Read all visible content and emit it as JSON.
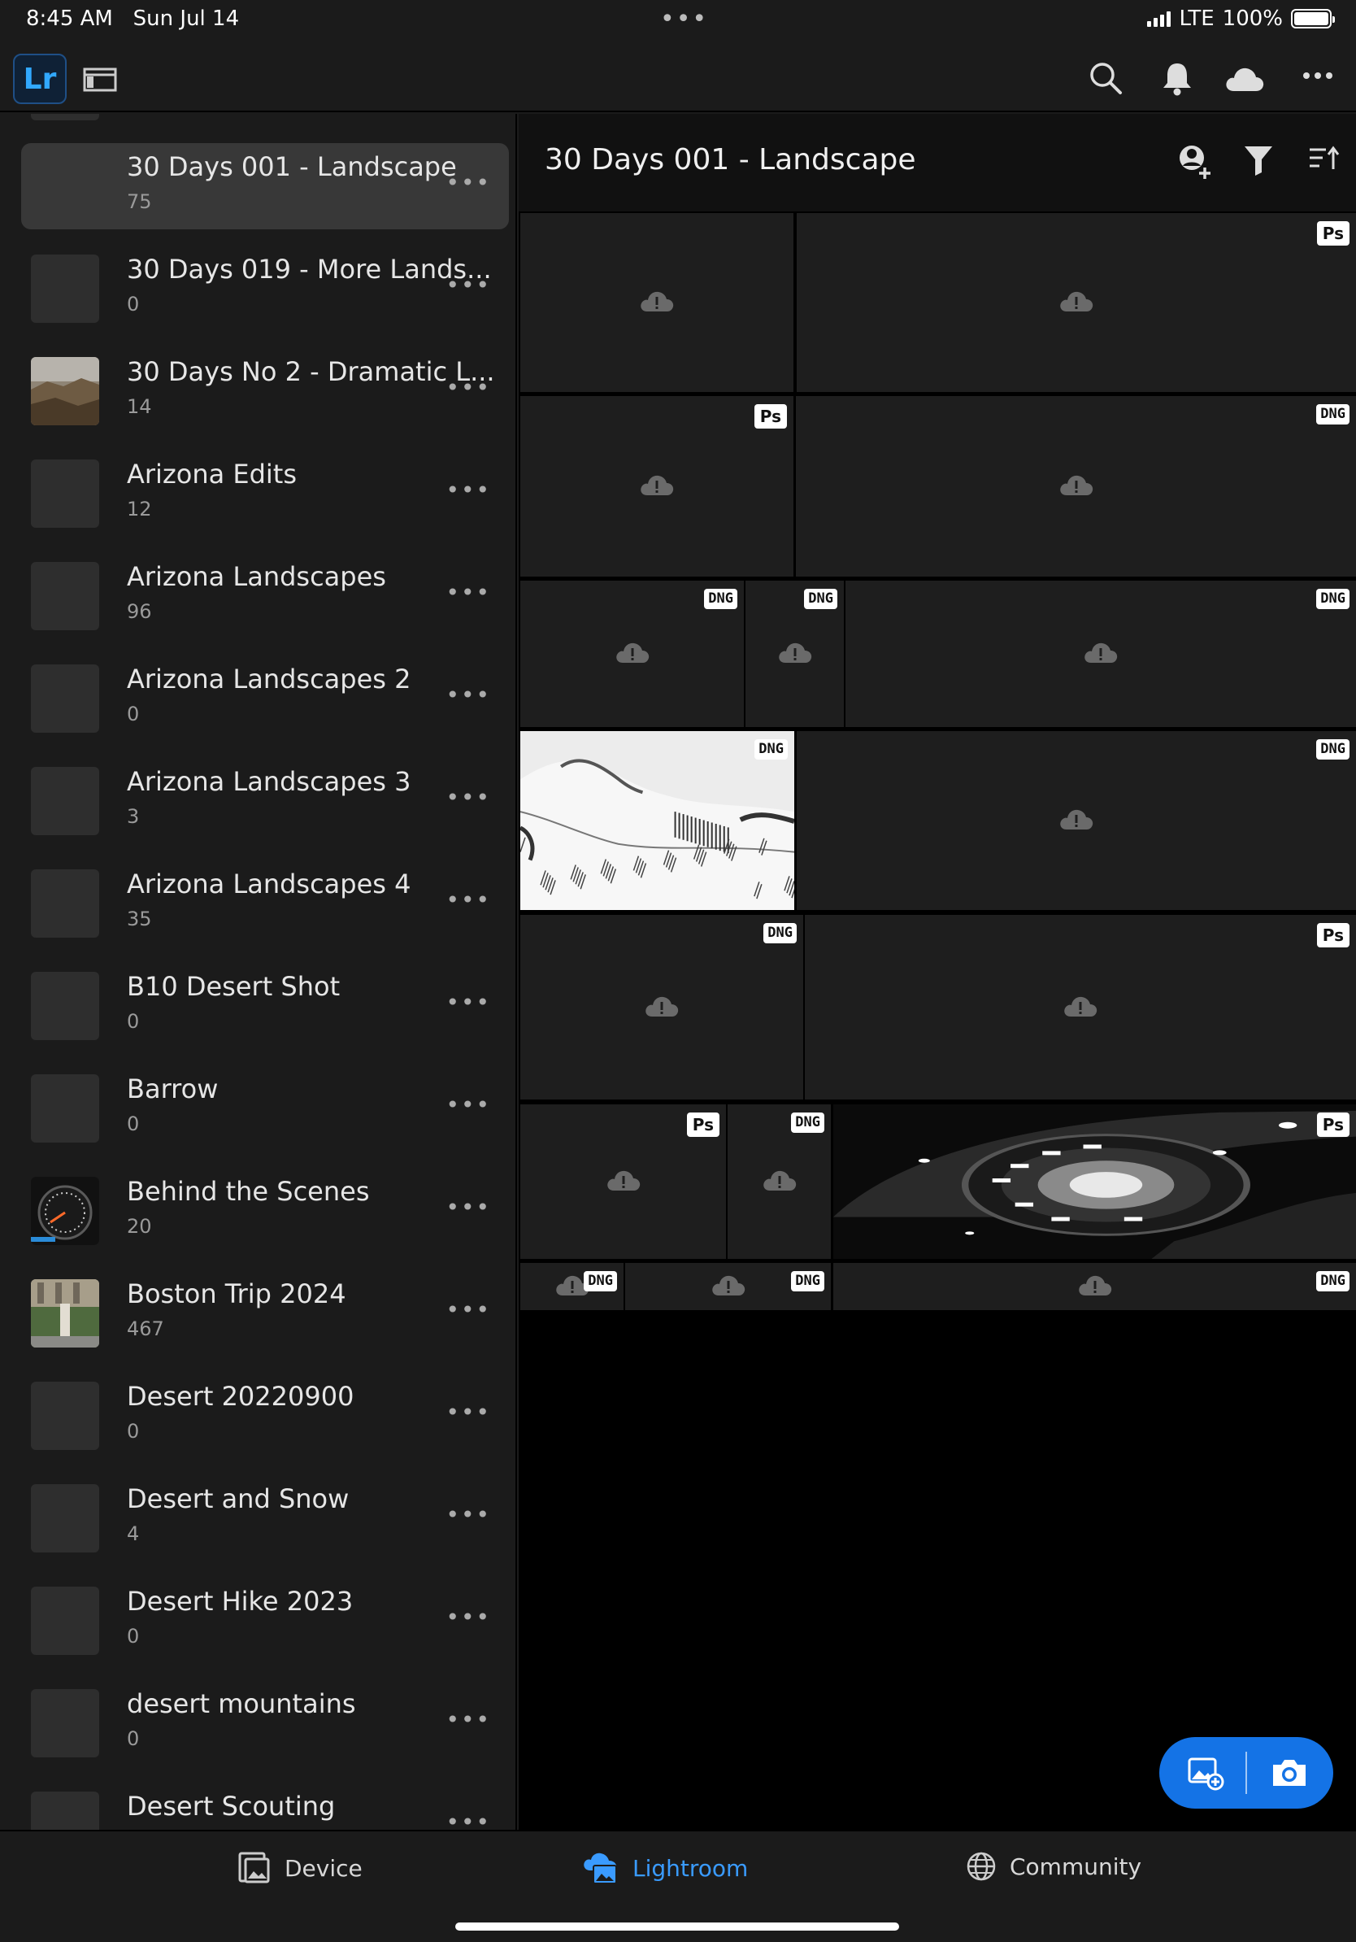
{
  "status_bar": {
    "time": "8:45 AM",
    "date": "Sun Jul 14",
    "network": "LTE",
    "battery": "100%"
  },
  "app_bar": {
    "logo": "Lr",
    "icons": [
      "panel-toggle-icon",
      "search-icon",
      "bell-icon",
      "cloud-icon",
      "more-icon"
    ]
  },
  "albums": [
    {
      "title": "30 Days 001 - Landscape",
      "count": "75",
      "selected": true,
      "thumb": "empty"
    },
    {
      "title": "30 Days 019 - More Lands...",
      "count": "0",
      "thumb": "empty"
    },
    {
      "title": "30 Days No 2 - Dramatic L...",
      "count": "14",
      "thumb": "landscape"
    },
    {
      "title": "Arizona Edits",
      "count": "12",
      "thumb": "empty"
    },
    {
      "title": "Arizona Landscapes",
      "count": "96",
      "thumb": "empty"
    },
    {
      "title": "Arizona Landscapes 2",
      "count": "0",
      "thumb": "empty"
    },
    {
      "title": "Arizona Landscapes 3",
      "count": "3",
      "thumb": "empty"
    },
    {
      "title": "Arizona Landscapes 4",
      "count": "35",
      "thumb": "empty"
    },
    {
      "title": "B10 Desert Shot",
      "count": "0",
      "thumb": "empty"
    },
    {
      "title": "Barrow",
      "count": "0",
      "thumb": "empty"
    },
    {
      "title": "Behind the Scenes",
      "count": "20",
      "thumb": "gauge"
    },
    {
      "title": "Boston Trip 2024",
      "count": "467",
      "thumb": "boston"
    },
    {
      "title": "Desert 20220900",
      "count": "0",
      "thumb": "empty"
    },
    {
      "title": "Desert and Snow",
      "count": "4",
      "thumb": "empty"
    },
    {
      "title": "Desert Hike 2023",
      "count": "0",
      "thumb": "empty"
    },
    {
      "title": "desert mountains",
      "count": "0",
      "thumb": "empty"
    },
    {
      "title": "Desert Scouting",
      "count": "",
      "thumb": "empty"
    }
  ],
  "album_more_label": "•••",
  "main": {
    "title": "30 Days 001 - Landscape",
    "header_icons": [
      "add-person-icon",
      "filter-icon",
      "sort-icon"
    ]
  },
  "photos": [
    {
      "badge": "",
      "image": "cloud"
    },
    {
      "badge": "Ps",
      "image": "cloud"
    },
    {
      "badge": "Ps",
      "image": "cloud"
    },
    {
      "badge": "DNG",
      "image": "cloud"
    },
    {
      "badge": "DNG",
      "image": "cloud"
    },
    {
      "badge": "DNG",
      "image": "cloud"
    },
    {
      "badge": "DNG",
      "image": "cloud"
    },
    {
      "badge": "DNG",
      "image": "snow-dunes"
    },
    {
      "badge": "DNG",
      "image": "cloud"
    },
    {
      "badge": "DNG",
      "image": "cloud"
    },
    {
      "badge": "Ps",
      "image": "cloud"
    },
    {
      "badge": "Ps",
      "image": "cloud"
    },
    {
      "badge": "DNG",
      "image": "cloud"
    },
    {
      "badge": "Ps",
      "image": "dome"
    },
    {
      "badge": "DNG",
      "image": "cloud"
    },
    {
      "badge": "DNG",
      "image": "cloud"
    },
    {
      "badge": "DNG",
      "image": "cloud"
    }
  ],
  "fab": {
    "icons": [
      "add-photo-icon",
      "camera-icon"
    ]
  },
  "bottom_nav": [
    {
      "label": "Device",
      "icon": "device-icon",
      "active": false
    },
    {
      "label": "Lightroom",
      "icon": "lightroom-cloud-icon",
      "active": true
    },
    {
      "label": "Community",
      "icon": "globe-icon",
      "active": false
    }
  ],
  "colors": {
    "accent": "#1473e6",
    "active_nav": "#3a9bff",
    "background": "#1b1b1b"
  }
}
